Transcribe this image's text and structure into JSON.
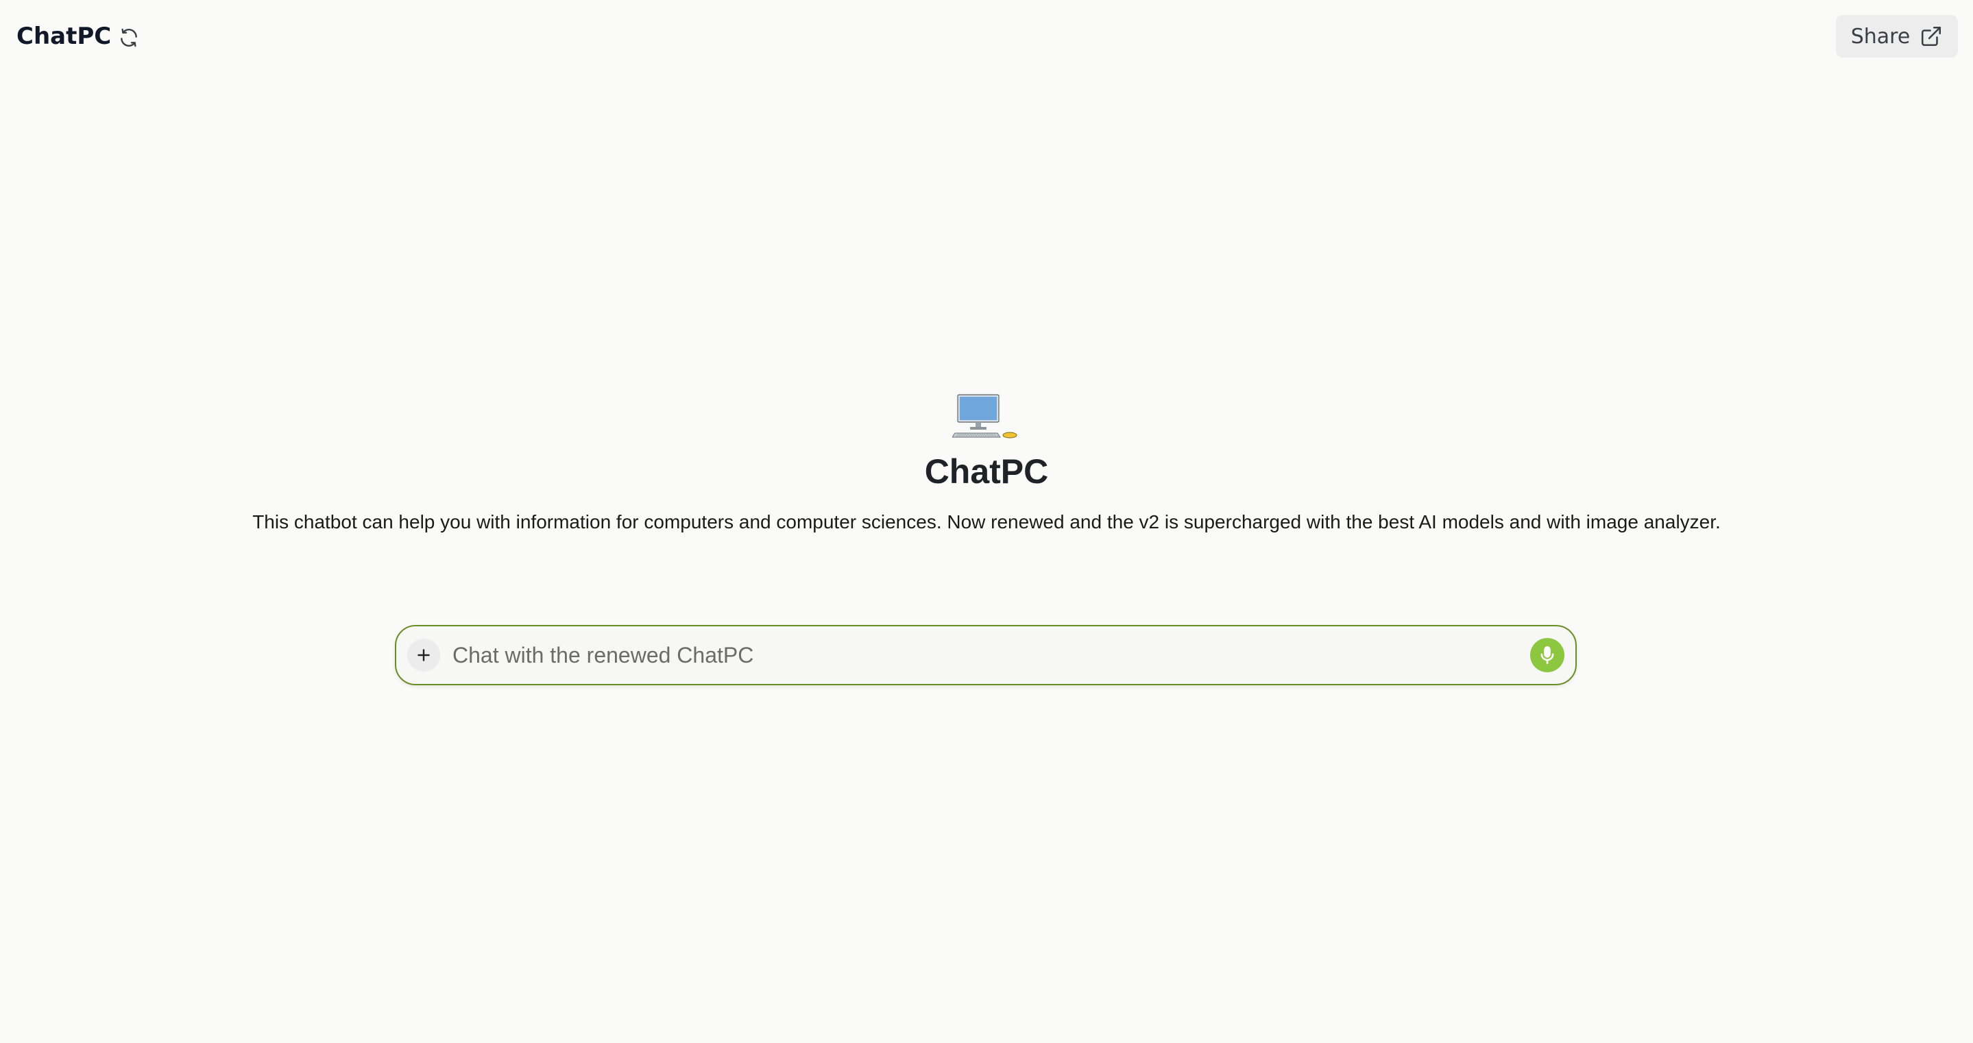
{
  "header": {
    "title": "ChatPC",
    "refresh_icon": "refresh-icon",
    "share_label": "Share",
    "share_icon": "external-link-icon"
  },
  "hero": {
    "logo_icon": "desktop-computer-icon",
    "title": "ChatPC",
    "description": "This chatbot can help you with information for computers and computer sciences. Now renewed and the v2 is supercharged with the best AI models and with image analyzer."
  },
  "chat": {
    "placeholder": "Chat with the renewed ChatPC",
    "value": "",
    "attach_icon": "plus-icon",
    "voice_icon": "microphone-icon"
  },
  "colors": {
    "accent_border": "#6b8e23",
    "mic_background": "#8dc63f",
    "background": "#fafaf9"
  }
}
